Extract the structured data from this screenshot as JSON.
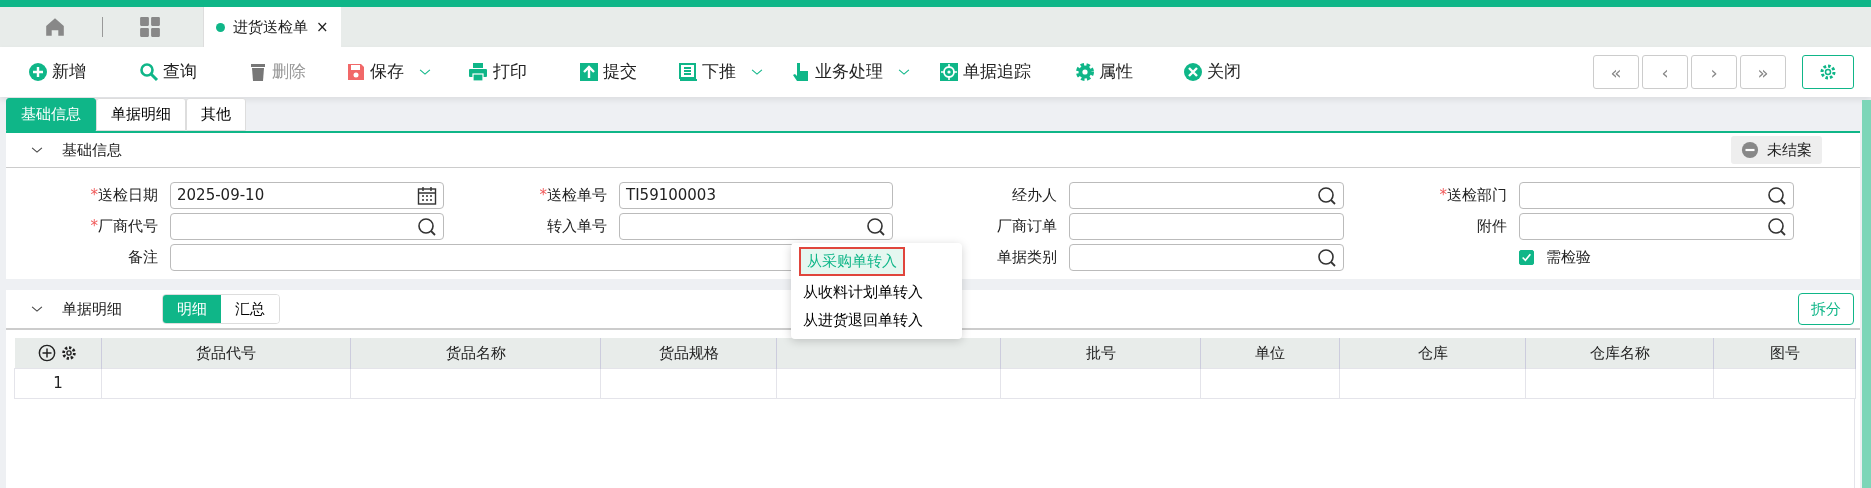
{
  "doc_tab": {
    "label": "进货送检单",
    "close": "×",
    "selected": true
  },
  "toolbar": [
    {
      "kind": "add",
      "label": "新增",
      "disabled": false,
      "dropdown": false
    },
    {
      "kind": "search",
      "label": "查询",
      "disabled": false,
      "dropdown": false
    },
    {
      "kind": "delete",
      "label": "删除",
      "disabled": true,
      "dropdown": false
    },
    {
      "kind": "save",
      "label": "保存",
      "disabled": false,
      "dropdown": true
    },
    {
      "kind": "print",
      "label": "打印",
      "disabled": false,
      "dropdown": false
    },
    {
      "kind": "submit",
      "label": "提交",
      "disabled": false,
      "dropdown": false
    },
    {
      "kind": "push",
      "label": "下推",
      "disabled": false,
      "dropdown": true
    },
    {
      "kind": "hand",
      "label": "业务处理",
      "disabled": false,
      "dropdown": true
    },
    {
      "kind": "track",
      "label": "单据追踪",
      "disabled": false,
      "dropdown": false
    },
    {
      "kind": "gear",
      "label": "属性",
      "disabled": false,
      "dropdown": false
    },
    {
      "kind": "close",
      "label": "关闭",
      "disabled": false,
      "dropdown": false
    }
  ],
  "nav_buttons": [
    "«",
    "‹",
    "›",
    "»"
  ],
  "subtabs": [
    {
      "label": "基础信息",
      "selected": true
    },
    {
      "label": "单据明细",
      "selected": false
    },
    {
      "label": "其他",
      "selected": false
    }
  ],
  "basic_section": {
    "title": "基础信息",
    "expanded": true,
    "status": "未结案",
    "required_mark": "*",
    "fields": [
      {
        "kind": "date",
        "label": "送检日期",
        "required": true,
        "value": "2025-09-10"
      },
      {
        "kind": "text",
        "label": "送检单号",
        "required": true,
        "value": "TI59100003"
      },
      {
        "kind": "lookup",
        "label": "经办人",
        "required": false
      },
      {
        "kind": "lookup",
        "label": "送检部门",
        "required": true
      },
      {
        "kind": "lookup",
        "label": "厂商代号",
        "required": true
      },
      {
        "kind": "lookup",
        "label": "转入单号",
        "required": false
      },
      {
        "kind": "text",
        "label": "厂商订单",
        "required": false
      },
      {
        "kind": "lookup",
        "label": "附件",
        "required": false
      },
      {
        "kind": "memo",
        "label": "备注",
        "required": false
      },
      {
        "kind": "lookup",
        "label": "单据类别",
        "required": false
      },
      {
        "kind": "check",
        "label": "需检验",
        "checked": true
      }
    ]
  },
  "detail_section": {
    "title": "单据明细",
    "expanded": true,
    "views": [
      {
        "label": "明细",
        "selected": true
      },
      {
        "label": "汇总",
        "selected": false
      }
    ],
    "split_button": "拆分",
    "table": {
      "columns": [
        "货品代号",
        "货品名称",
        "货品规格",
        "批号",
        "单位",
        "仓库",
        "仓库名称",
        "图号"
      ],
      "rows": [
        {
          "number": "1"
        }
      ]
    }
  },
  "transfer_menu": {
    "items": [
      {
        "label": "从采购单转入",
        "selected": true
      },
      {
        "label": "从收料计划单转入",
        "selected": false
      },
      {
        "label": "从进货退回单转入",
        "selected": false
      }
    ]
  }
}
